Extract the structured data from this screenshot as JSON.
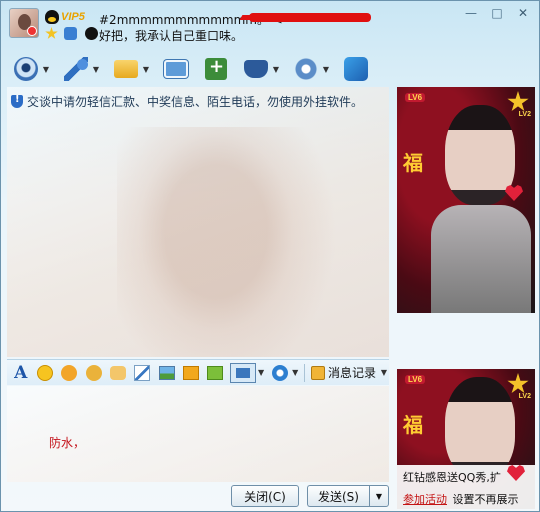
{
  "header": {
    "vip_label": "VIP5",
    "nickname": "#2mmmmmmmmmmmm。 <",
    "signature": "好把，我承认自己重口味。"
  },
  "window_controls": {
    "minimize": "—",
    "maximize": "□",
    "close": "✕"
  },
  "toolbar": {
    "items": [
      "camera-icon",
      "microphone-icon",
      "file-transfer-icon",
      "send-card-icon",
      "add-app-icon",
      "remote-assist-icon",
      "settings-icon",
      "share-icon"
    ]
  },
  "chat": {
    "notice": "交谈中请勿轻信汇款、中奖信息、陌生电话，勿使用外挂软件。"
  },
  "format_bar": {
    "font_label": "A",
    "history_label": "消息记录"
  },
  "input": {
    "text": "防水，"
  },
  "buttons": {
    "close_label": "关闭(C)",
    "send_label": "发送(S)"
  },
  "show_panel": {
    "level_badge": "LV6",
    "level_small": "LV2",
    "ad_text": "红钻感恩送QQ秀,扩",
    "ad_link": "参加活动",
    "ad_hide": "设置不再展示"
  },
  "colors": {
    "accent": "#2b6cc6",
    "warning_red": "#c4141c",
    "vip_gold": "#e8a300"
  }
}
